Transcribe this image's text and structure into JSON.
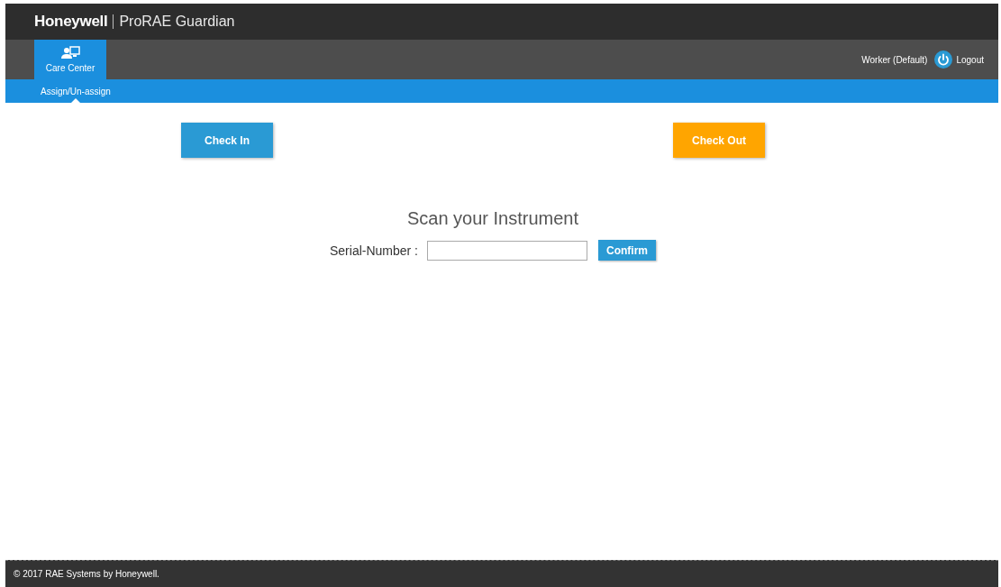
{
  "header": {
    "brand": "Honeywell",
    "product": "ProRAE Guardian"
  },
  "nav": {
    "tabs": [
      {
        "label": "Care Center",
        "selected": true
      }
    ],
    "user": "Worker (Default)",
    "logout": "Logout"
  },
  "subnav": {
    "items": [
      {
        "label": "Assign/Un-assign",
        "selected": true
      }
    ]
  },
  "actions": [
    {
      "label": "Check In",
      "kind": "primary"
    },
    {
      "label": "Check Out",
      "kind": "warning"
    }
  ],
  "scan": {
    "title": "Scan your Instrument",
    "field_label": "Serial-Number :",
    "confirm": "Confirm"
  },
  "footer": "© 2017 RAE Systems by Honeywell."
}
